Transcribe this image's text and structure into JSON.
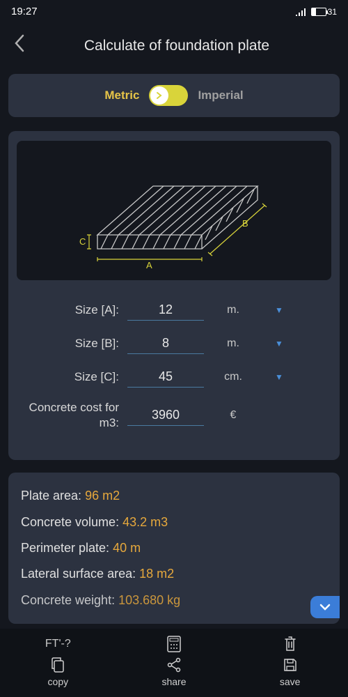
{
  "status": {
    "time": "19:27",
    "battery": "31"
  },
  "header": {
    "title": "Calculate of foundation plate"
  },
  "units": {
    "metric": "Metric",
    "imperial": "Imperial"
  },
  "diagram": {
    "a": "A",
    "b": "B",
    "c": "C"
  },
  "inputs": {
    "sizeA": {
      "label": "Size [A]:",
      "value": "12",
      "unit": "m."
    },
    "sizeB": {
      "label": "Size [B]:",
      "value": "8",
      "unit": "m."
    },
    "sizeC": {
      "label": "Size [C]:",
      "value": "45",
      "unit": "cm."
    },
    "cost": {
      "label": "Concrete cost for m3:",
      "value": "3960",
      "unit": "€"
    }
  },
  "results": {
    "plateArea": {
      "label": "Plate area: ",
      "value": "96 m2"
    },
    "volume": {
      "label": "Concrete volume: ",
      "value": "43.2 m3"
    },
    "perimeter": {
      "label": "Perimeter plate: ",
      "value": "40 m"
    },
    "lateral": {
      "label": "Lateral surface area: ",
      "value": "18 m2"
    },
    "weight": {
      "label": "Concrete weight: ",
      "value": "103.680 kg"
    }
  },
  "bottom": {
    "ft": "FT'-?",
    "copy": "copy",
    "share": "share",
    "save": "save"
  }
}
